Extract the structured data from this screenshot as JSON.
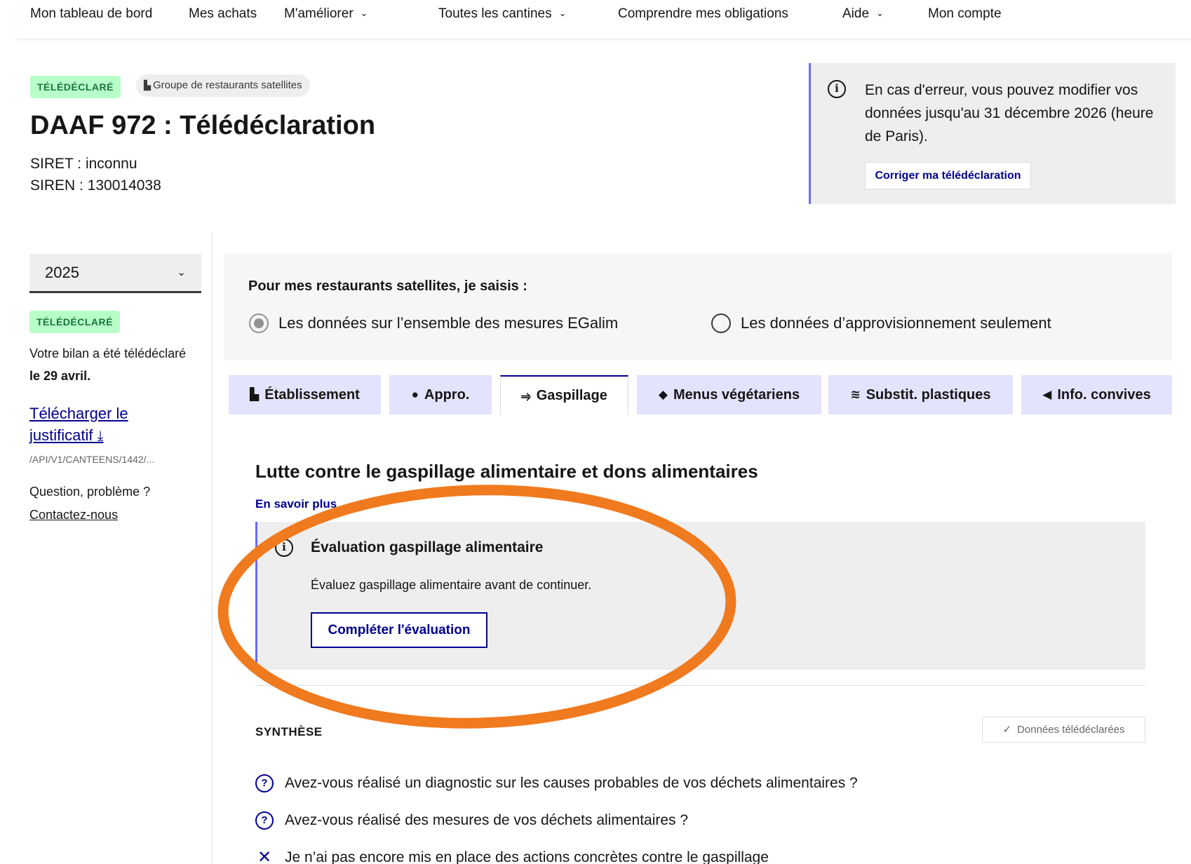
{
  "nav": {
    "items": [
      {
        "label": "Mon tableau de bord",
        "has_menu": false
      },
      {
        "label": "Mes achats",
        "has_menu": false
      },
      {
        "label": "M'améliorer",
        "has_menu": true
      },
      {
        "label": "Toutes les cantines",
        "has_menu": true
      },
      {
        "label": "Comprendre mes obligations",
        "has_menu": false
      },
      {
        "label": "Aide",
        "has_menu": true
      },
      {
        "label": "Mon compte",
        "has_menu": false
      }
    ]
  },
  "header": {
    "status_badge": "TÉLÉDÉCLARÉ",
    "group_chip": "Groupe de restaurants satellites",
    "title": "DAAF 972 : Télédéclaration",
    "siret": "SIRET : inconnu",
    "siren": "SIREN : 130014038"
  },
  "callout": {
    "text": "En cas d'erreur, vous pouvez modifier vos données jusqu'au 31 décembre 2026 (heure de Paris).",
    "button": "Corriger ma télédéclaration"
  },
  "sidebar": {
    "year": "2025",
    "status_badge": "TÉLÉDÉCLARÉ",
    "bilan_prefix": "Votre bilan a été télédéclaré ",
    "bilan_date": "le 29 avril.",
    "download_link": "Télécharger le justificatif",
    "path": "/API/V1/CANTEENS/1442/...",
    "question": "Question, problème ?",
    "contact_link": "Contactez-nous"
  },
  "mode": {
    "label": "Pour mes restaurants satellites, je saisis :",
    "options": [
      {
        "label": "Les données sur l’ensemble des mesures EGalim",
        "selected": true
      },
      {
        "label": "Les données d’approvisionnement seulement",
        "selected": false
      }
    ]
  },
  "tabs": [
    {
      "label": "Établissement",
      "icon": "building-icon",
      "glyph": "▙"
    },
    {
      "label": "Appro.",
      "icon": "apple-icon",
      "glyph": "●"
    },
    {
      "label": "Gaspillage",
      "icon": "waste-icon",
      "glyph": "⥤",
      "active": true
    },
    {
      "label": "Menus végétariens",
      "icon": "leaf-icon",
      "glyph": "◆"
    },
    {
      "label": "Substit. plastiques",
      "icon": "wind-icon",
      "glyph": "≋"
    },
    {
      "label": "Info. convives",
      "icon": "megaphone-icon",
      "glyph": "◀"
    }
  ],
  "section": {
    "title": "Lutte contre le gaspillage alimentaire et dons alimentaires",
    "learn_more": "En savoir plus",
    "eval_title": "Évaluation gaspillage alimentaire",
    "eval_desc": "Évaluez gaspillage alimentaire avant de continuer.",
    "eval_button": "Compléter l'évaluation"
  },
  "synthese": {
    "label": "SYNTHÈSE",
    "status": "Données télédéclarées",
    "questions": [
      {
        "text": "Avez-vous réalisé un diagnostic sur les causes probables de vos déchets alimentaires ?",
        "icon": "question-icon"
      },
      {
        "text": "Avez-vous réalisé des mesures de vos déchets alimentaires ?",
        "icon": "question-icon"
      },
      {
        "text": "Je n’ai pas encore mis en place des actions concrètes contre le gaspillage",
        "icon": "cross-icon"
      }
    ]
  },
  "colors": {
    "primary": "#000091",
    "success_bg": "#b8fec9",
    "success_text": "#18753c",
    "tab_bg": "#e3e3fd",
    "annotation": "#f07a1e"
  }
}
